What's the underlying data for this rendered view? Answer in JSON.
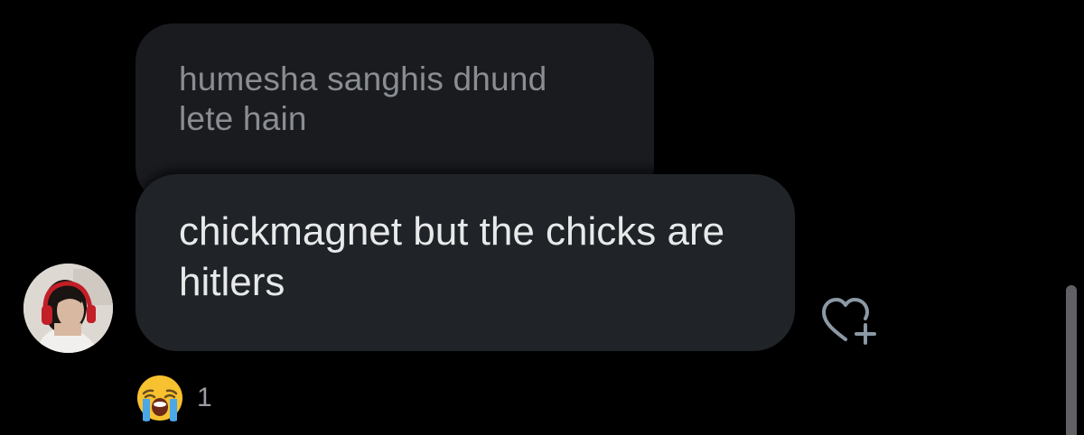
{
  "quoted_message": {
    "text": "humesha sanghis dhund lete hain"
  },
  "message": {
    "text": "chickmagnet but the chicks are hitlers",
    "avatar_icon": "user-avatar-photo"
  },
  "actions": {
    "react_icon": "heart-plus-icon"
  },
  "reactions": [
    {
      "emoji": "loudly-crying-face",
      "count": "1"
    }
  ],
  "colors": {
    "background": "#000000",
    "quoted_bubble": "#191b1f",
    "message_bubble": "#202327",
    "quoted_text": "#8a8d92",
    "message_text": "#e7e9ea",
    "muted": "#9a9da1"
  }
}
